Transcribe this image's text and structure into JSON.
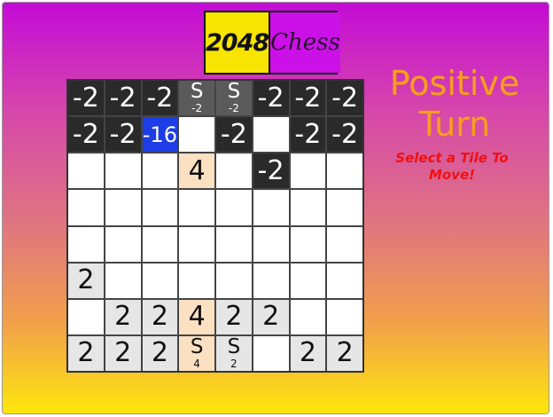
{
  "logo": {
    "left": "2048",
    "right": "Chess"
  },
  "status": {
    "title": "Positive Turn",
    "hint": "Select a Tile To Move!"
  },
  "colors": {
    "background_top": "#c40bd6",
    "background_bottom": "#fde60c",
    "negative_tile": "#2a2a2a",
    "negative_16_tile": "#1d3de6",
    "positive_tile": "#e6e6e6",
    "positive_4_tile": "#fbe0c2",
    "title_text": "#f79d24",
    "hint_text": "#ee1111"
  },
  "board": {
    "rows": [
      [
        {
          "kind": "neg",
          "label": "-2"
        },
        {
          "kind": "neg",
          "label": "-2"
        },
        {
          "kind": "neg",
          "label": "-2"
        },
        {
          "kind": "snegs",
          "symbol": "S",
          "sub": "-2"
        },
        {
          "kind": "snegs",
          "symbol": "S",
          "sub": "-2"
        },
        {
          "kind": "neg",
          "label": "-2"
        },
        {
          "kind": "neg",
          "label": "-2"
        },
        {
          "kind": "neg",
          "label": "-2"
        }
      ],
      [
        {
          "kind": "neg",
          "label": "-2"
        },
        {
          "kind": "neg",
          "label": "-2"
        },
        {
          "kind": "neg16",
          "label": "-16"
        },
        {
          "kind": "empty"
        },
        {
          "kind": "neg",
          "label": "-2"
        },
        {
          "kind": "empty"
        },
        {
          "kind": "neg",
          "label": "-2"
        },
        {
          "kind": "neg",
          "label": "-2"
        }
      ],
      [
        {
          "kind": "empty"
        },
        {
          "kind": "empty"
        },
        {
          "kind": "empty"
        },
        {
          "kind": "pos4",
          "label": "4"
        },
        {
          "kind": "empty"
        },
        {
          "kind": "neg",
          "label": "-2"
        },
        {
          "kind": "empty"
        },
        {
          "kind": "empty"
        }
      ],
      [
        {
          "kind": "empty"
        },
        {
          "kind": "empty"
        },
        {
          "kind": "empty"
        },
        {
          "kind": "empty"
        },
        {
          "kind": "empty"
        },
        {
          "kind": "empty"
        },
        {
          "kind": "empty"
        },
        {
          "kind": "empty"
        }
      ],
      [
        {
          "kind": "empty"
        },
        {
          "kind": "empty"
        },
        {
          "kind": "empty"
        },
        {
          "kind": "empty"
        },
        {
          "kind": "empty"
        },
        {
          "kind": "empty"
        },
        {
          "kind": "empty"
        },
        {
          "kind": "empty"
        }
      ],
      [
        {
          "kind": "pos",
          "label": "2"
        },
        {
          "kind": "empty"
        },
        {
          "kind": "empty"
        },
        {
          "kind": "empty"
        },
        {
          "kind": "empty"
        },
        {
          "kind": "empty"
        },
        {
          "kind": "empty"
        },
        {
          "kind": "empty"
        }
      ],
      [
        {
          "kind": "empty"
        },
        {
          "kind": "pos",
          "label": "2"
        },
        {
          "kind": "pos",
          "label": "2"
        },
        {
          "kind": "pos4",
          "label": "4"
        },
        {
          "kind": "pos",
          "label": "2"
        },
        {
          "kind": "pos",
          "label": "2"
        },
        {
          "kind": "empty"
        },
        {
          "kind": "empty"
        }
      ],
      [
        {
          "kind": "pos",
          "label": "2"
        },
        {
          "kind": "pos",
          "label": "2"
        },
        {
          "kind": "pos",
          "label": "2"
        },
        {
          "kind": "poss4",
          "symbol": "S",
          "sub": "4"
        },
        {
          "kind": "poss",
          "symbol": "S",
          "sub": "2"
        },
        {
          "kind": "empty"
        },
        {
          "kind": "pos",
          "label": "2"
        },
        {
          "kind": "pos",
          "label": "2"
        }
      ]
    ]
  }
}
